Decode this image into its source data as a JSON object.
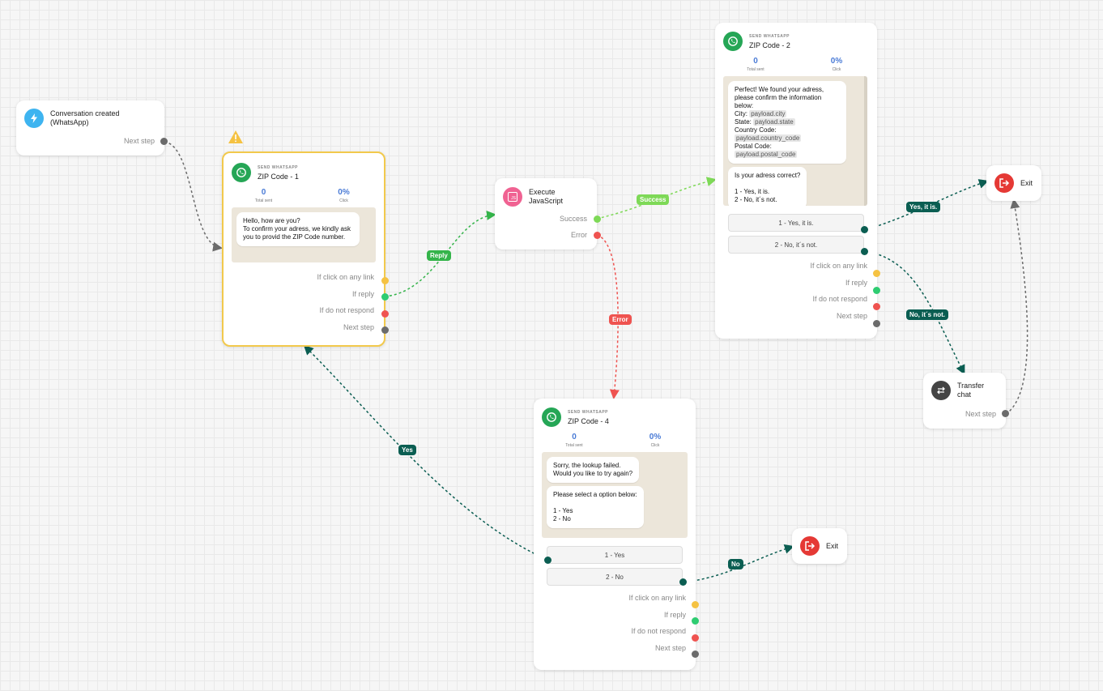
{
  "colors": {
    "whatsapp": "#25a656",
    "trigger": "#3eb4f0",
    "javascript": "#f06292",
    "exit": "#e53935",
    "transfer": "#444444",
    "edge_teal": "#0b5e52",
    "edge_green": "#34b44a",
    "edge_lime": "#7ed957",
    "edge_red": "#ef5350",
    "selected_border": "#f2c94c",
    "stat_blue": "#4a7bd6"
  },
  "trigger": {
    "title": "Conversation created (WhatsApp)",
    "next": "Next step",
    "icon": "bolt-icon"
  },
  "js_node": {
    "title": "Execute JavaScript",
    "icon_text": "JS",
    "success": "Success",
    "error": "Error"
  },
  "zip1": {
    "type": "SEND WHATSAPP",
    "name": "ZIP Code - 1",
    "stats": {
      "sent_value": "0",
      "sent_label": "Total sent",
      "click_value": "0%",
      "click_label": "Click"
    },
    "message": "Hello, how are you?\nTo confirm your adress, we kindly ask you to provid the ZIP Code number.",
    "ports": {
      "link": "If click on any link",
      "reply": "If reply",
      "no_respond": "If do not respond",
      "next": "Next step"
    },
    "warning_icon": "warning-icon"
  },
  "zip2": {
    "type": "SEND WHATSAPP",
    "name": "ZIP Code - 2",
    "stats": {
      "sent_value": "0",
      "sent_label": "Total sent",
      "click_value": "0%",
      "click_label": "Click"
    },
    "message_lines": {
      "l1": "Perfect! We found your adress, please confirm the information below:",
      "city": "City:",
      "city_tag": "payload.city",
      "state": "State:",
      "state_tag": "payload.state",
      "country": "Country Code:",
      "country_tag": "payload.country_code",
      "postal": "Postal Code:",
      "postal_tag": "payload.postal_code"
    },
    "message2": "Is your adress correct?\n\n1 - Yes, it is.\n2 - No, it´s not.",
    "options": [
      "1 - Yes, it is.",
      "2 - No, it´s not."
    ],
    "ports": {
      "link": "If click on any link",
      "reply": "If reply",
      "no_respond": "If do not respond",
      "next": "Next step"
    }
  },
  "zip4": {
    "type": "SEND WHATSAPP",
    "name": "ZIP Code - 4",
    "stats": {
      "sent_value": "0",
      "sent_label": "Total sent",
      "click_value": "0%",
      "click_label": "Click"
    },
    "message1": "Sorry, the lookup failed.\nWould you like to try again?",
    "message2": "Please select a option below:\n\n1 - Yes\n2 - No",
    "options": [
      "1 - Yes",
      "2 - No"
    ],
    "ports": {
      "link": "If click on any link",
      "reply": "If reply",
      "no_respond": "If do not respond",
      "next": "Next step"
    }
  },
  "exit_top": {
    "title": "Exit"
  },
  "exit_bottom": {
    "title": "Exit"
  },
  "transfer": {
    "title": "Transfer chat",
    "next": "Next step"
  },
  "edge_labels": {
    "reply": "Reply",
    "success": "Success",
    "error": "Error",
    "yes_it_is": "Yes, it is.",
    "no_its_not": "No, it´s not.",
    "yes": "Yes",
    "no": "No"
  }
}
